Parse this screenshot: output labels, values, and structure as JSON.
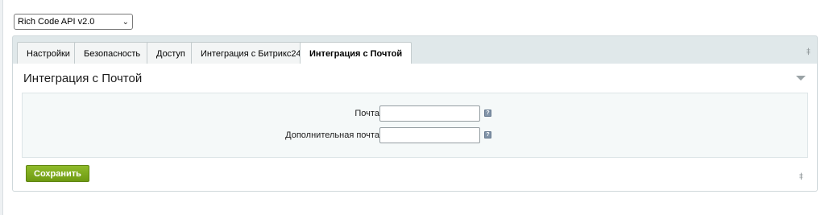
{
  "module_select": {
    "value": "Rich Code API v2.0",
    "chevron_icon": "chevron-down-icon"
  },
  "tabs": [
    {
      "label": "Настройки",
      "active": false
    },
    {
      "label": "Безопасность",
      "active": false
    },
    {
      "label": "Доступ",
      "active": false
    },
    {
      "label": "Интеграция с Битрикс24",
      "active": false
    },
    {
      "label": "Интеграция с Почтой",
      "active": true
    }
  ],
  "panel": {
    "title": "Интеграция с Почтой",
    "fields": [
      {
        "label": "Почта:",
        "value": "",
        "help_icon": "help-icon"
      },
      {
        "label": "Дополнительная почта:",
        "value": "",
        "help_icon": "help-icon"
      }
    ],
    "save_label": "Сохранить"
  },
  "icons": {
    "pin": "pin-icon",
    "collapse": "collapse-arrow-icon"
  },
  "colors": {
    "tab_bar": "#e0e8ea",
    "save_button": "#7aa81c",
    "form_bg": "#f5f9f9"
  }
}
